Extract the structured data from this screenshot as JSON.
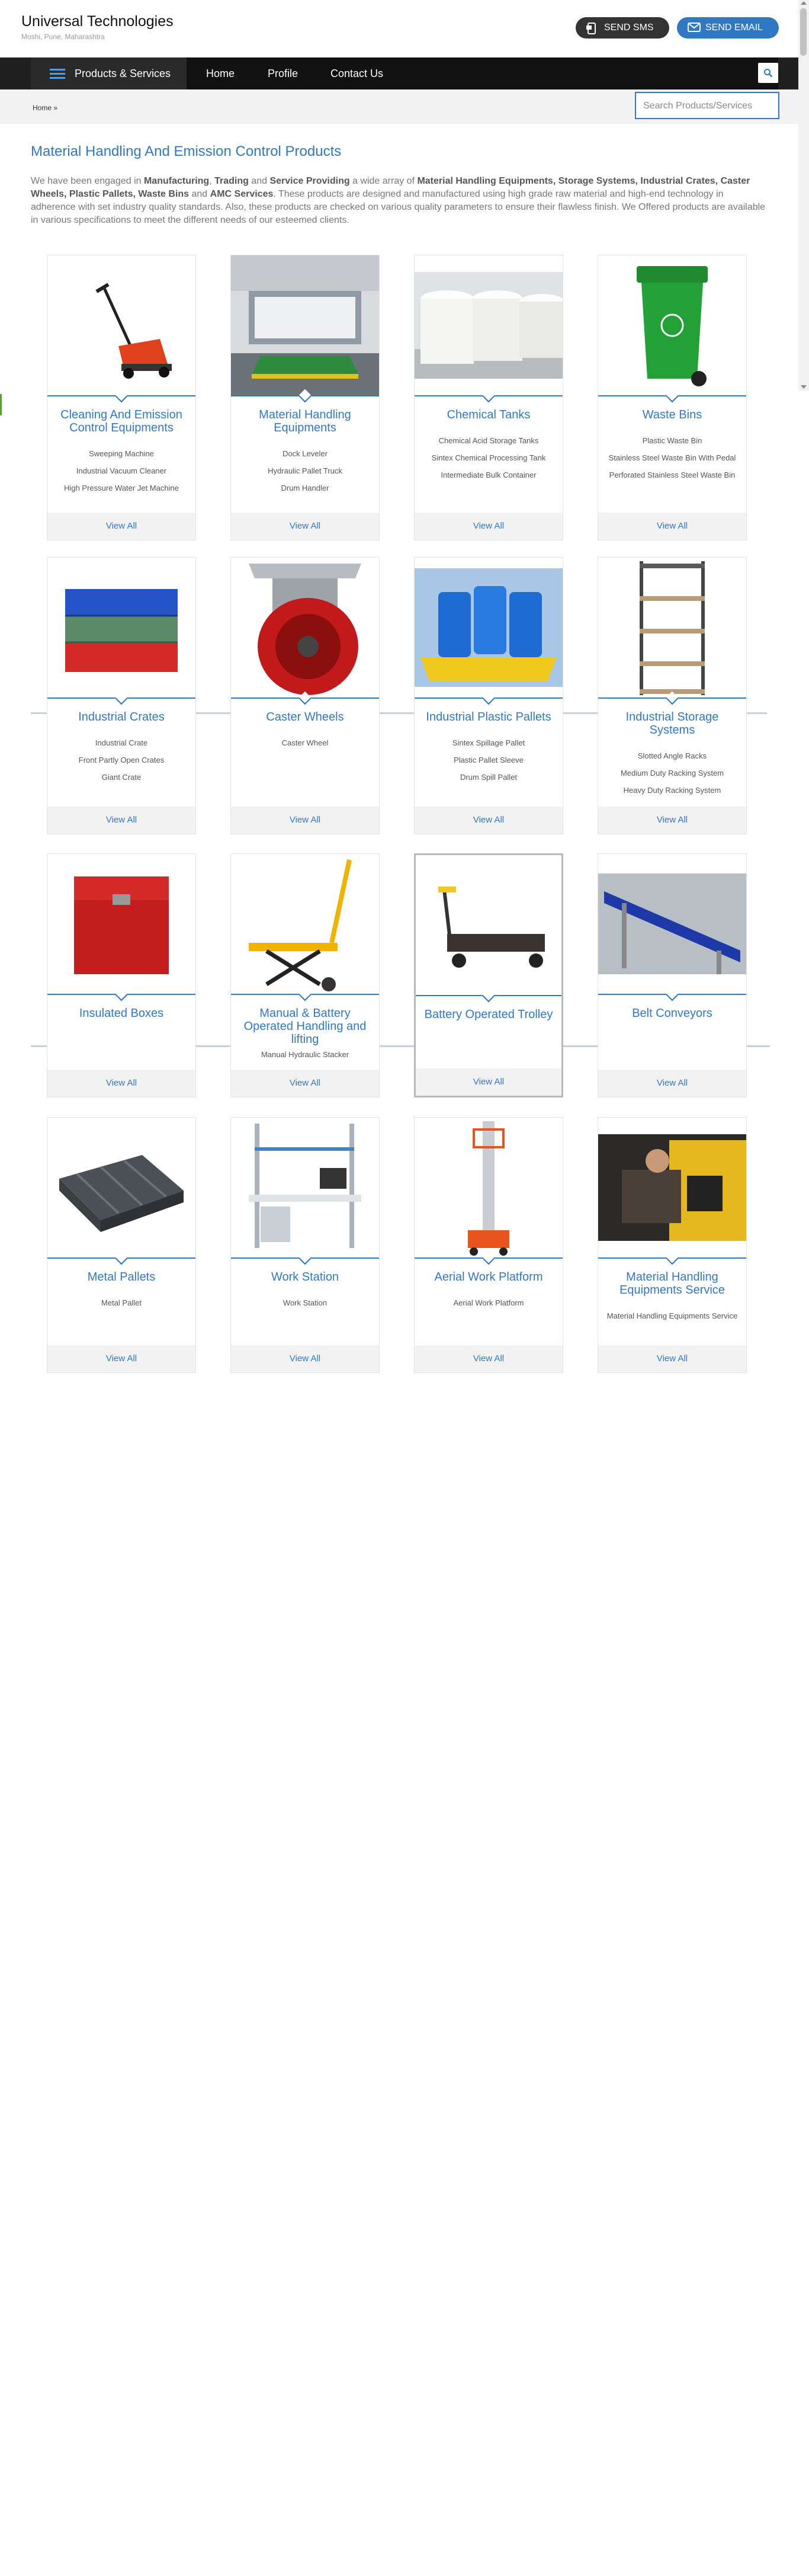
{
  "header": {
    "brand_name": "Universal Technologies",
    "brand_location": "Moshi, Pune, Maharashtra",
    "sms_label": "SEND SMS",
    "email_label": "SEND EMAIL"
  },
  "nav": {
    "products_label": "Products & Services",
    "items": [
      "Home",
      "Profile",
      "Contact Us"
    ]
  },
  "breadcrumb": {
    "home": "Home »"
  },
  "search": {
    "placeholder": "Search Products/Services"
  },
  "main": {
    "title": "Material Handling And Emission Control Products",
    "intro": {
      "p1": "We have been engaged in ",
      "b1": "Manufacturing",
      "p2": ", ",
      "b2": "Trading",
      "p3": " and ",
      "b3": "Service Providing",
      "p4": " a wide array of ",
      "b4": "Material Handling Equipments, Storage Systems, Industrial Crates, Caster Wheels, Plastic Pallets, Waste Bins",
      "p5": " and ",
      "b5": "AMC Services",
      "p6": ". These products are designed and manufactured using high grade raw material and high-end technology in adherence with set industry quality standards. Also, these products are checked on various quality parameters to ensure their flawless finish. We Offered products are available in various specifications to meet the different needs of our esteemed clients."
    },
    "view_all_label": "View All",
    "products": [
      {
        "title": "Cleaning And Emission Control Equipments",
        "icon": "sweeper-image",
        "subs": [
          "Sweeping Machine",
          "Industrial Vacuum Cleaner",
          "High Pressure Water Jet Machine"
        ]
      },
      {
        "title": "Material Handling Equipments",
        "icon": "dock-leveler-image",
        "subs": [
          "Dock Leveler",
          "Hydraulic Pallet Truck",
          "Drum Handler"
        ]
      },
      {
        "title": "Chemical Tanks",
        "icon": "chemical-tank-image",
        "subs": [
          "Chemical Acid Storage Tanks",
          "Sintex Chemical Processing Tank",
          "Intermediate Bulk Container"
        ]
      },
      {
        "title": "Waste Bins",
        "icon": "waste-bin-image",
        "subs": [
          "Plastic Waste Bin",
          "Stainless Steel Waste Bin With Pedal",
          "Perforated Stainless Steel Waste Bin"
        ]
      },
      {
        "title": "Industrial Crates",
        "icon": "crates-image",
        "subs": [
          "Industrial Crate",
          "Front Partly Open Crates",
          "Giant Crate"
        ]
      },
      {
        "title": "Caster Wheels",
        "icon": "caster-wheel-image",
        "subs": [
          "Caster Wheel"
        ]
      },
      {
        "title": "Industrial Plastic Pallets",
        "icon": "plastic-pallet-image",
        "subs": [
          "Sintex Spillage Pallet",
          "Plastic Pallet Sleeve",
          "Drum Spill Pallet"
        ]
      },
      {
        "title": "Industrial Storage Systems",
        "icon": "storage-rack-image",
        "subs": [
          "Slotted Angle Racks",
          "Medium Duty Racking System",
          "Heavy Duty Racking System"
        ]
      },
      {
        "title": "Insulated Boxes",
        "icon": "insulated-box-image",
        "subs": []
      },
      {
        "title": "Manual & Battery Operated Handling and lifting",
        "icon": "scissor-lift-image",
        "subs": [
          "Manual Hydraulic Stacker"
        ]
      },
      {
        "title": "Battery Operated Trolley",
        "icon": "trolley-image",
        "subs": []
      },
      {
        "title": "Belt Conveyors",
        "icon": "conveyor-image",
        "subs": []
      },
      {
        "title": "Metal Pallets",
        "icon": "metal-pallet-image",
        "subs": [
          "Metal Pallet"
        ]
      },
      {
        "title": "Work Station",
        "icon": "workstation-image",
        "subs": [
          "Work Station"
        ]
      },
      {
        "title": "Aerial Work Platform",
        "icon": "aerial-platform-image",
        "subs": [
          "Aerial Work Platform"
        ]
      },
      {
        "title": "Material Handling Equipments Service",
        "icon": "service-image",
        "subs": [
          "Material Handling Equipments Service"
        ]
      }
    ]
  }
}
